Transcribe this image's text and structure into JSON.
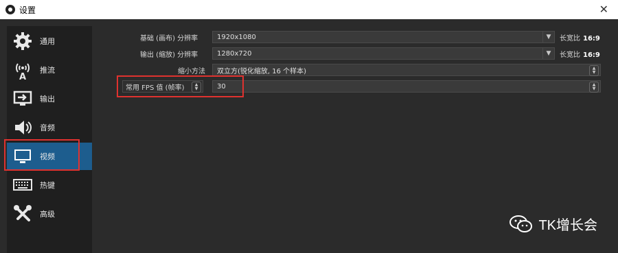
{
  "window": {
    "title": "设置",
    "close_label": "✕"
  },
  "sidebar": {
    "items": [
      {
        "label": "通用",
        "icon": "gear-icon"
      },
      {
        "label": "推流",
        "icon": "broadcast-icon"
      },
      {
        "label": "输出",
        "icon": "output-icon"
      },
      {
        "label": "音频",
        "icon": "speaker-icon"
      },
      {
        "label": "视频",
        "icon": "monitor-icon"
      },
      {
        "label": "热键",
        "icon": "keyboard-icon"
      },
      {
        "label": "高级",
        "icon": "tools-icon"
      }
    ],
    "active_index": 4
  },
  "video": {
    "base_resolution": {
      "label": "基础 (画布) 分辨率",
      "value": "1920x1080",
      "aspect_label": "长宽比",
      "aspect_value": "16:9"
    },
    "output_resolution": {
      "label": "输出 (缩放) 分辨率",
      "value": "1280x720",
      "aspect_label": "长宽比",
      "aspect_value": "16:9"
    },
    "downscale_filter": {
      "label": "缩小方法",
      "value": "双立方(锐化缩放, 16 个样本)"
    },
    "fps": {
      "label": "常用 FPS 值 (帧率)",
      "value": "30"
    }
  },
  "watermark": {
    "text": "TK增长会"
  },
  "colors": {
    "highlight": "#e0322f",
    "active": "#1d5d8e",
    "panel": "#2b2b2b"
  }
}
